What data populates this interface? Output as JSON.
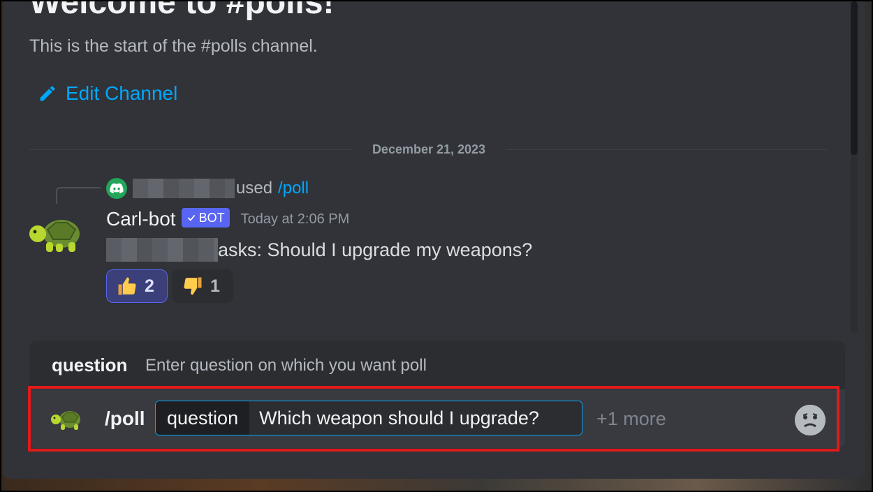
{
  "welcome": {
    "title": "Welcome to #polls!",
    "subtitle": "This is the start of the #polls channel.",
    "edit_channel_label": "Edit Channel"
  },
  "divider": {
    "date": "December 21, 2023"
  },
  "reply": {
    "used_text": "used",
    "command": "/poll"
  },
  "message": {
    "author": "Carl-bot",
    "bot_tag": "BOT",
    "timestamp": "Today at 2:06 PM",
    "body": "asks: Should I upgrade my weapons?",
    "reactions": [
      {
        "emoji": "thumbs-up",
        "count": "2",
        "active": true
      },
      {
        "emoji": "thumbs-down",
        "count": "1",
        "active": false
      }
    ]
  },
  "option_panel": {
    "name": "question",
    "description": "Enter question on which you want poll"
  },
  "input": {
    "command": "/poll",
    "param_label": "question",
    "param_value": "Which weapon should I upgrade?",
    "more": "+1 more"
  },
  "colors": {
    "background": "#313338",
    "link": "#00a8fc",
    "bot_tag": "#5865f2",
    "highlight_border": "#e21a1a",
    "online": "#23a559"
  },
  "icons": [
    "pencil-icon",
    "discord-icon",
    "turtle-avatar-icon",
    "check-icon",
    "thumbs-up-icon",
    "thumbs-down-icon",
    "emoji-icon"
  ]
}
